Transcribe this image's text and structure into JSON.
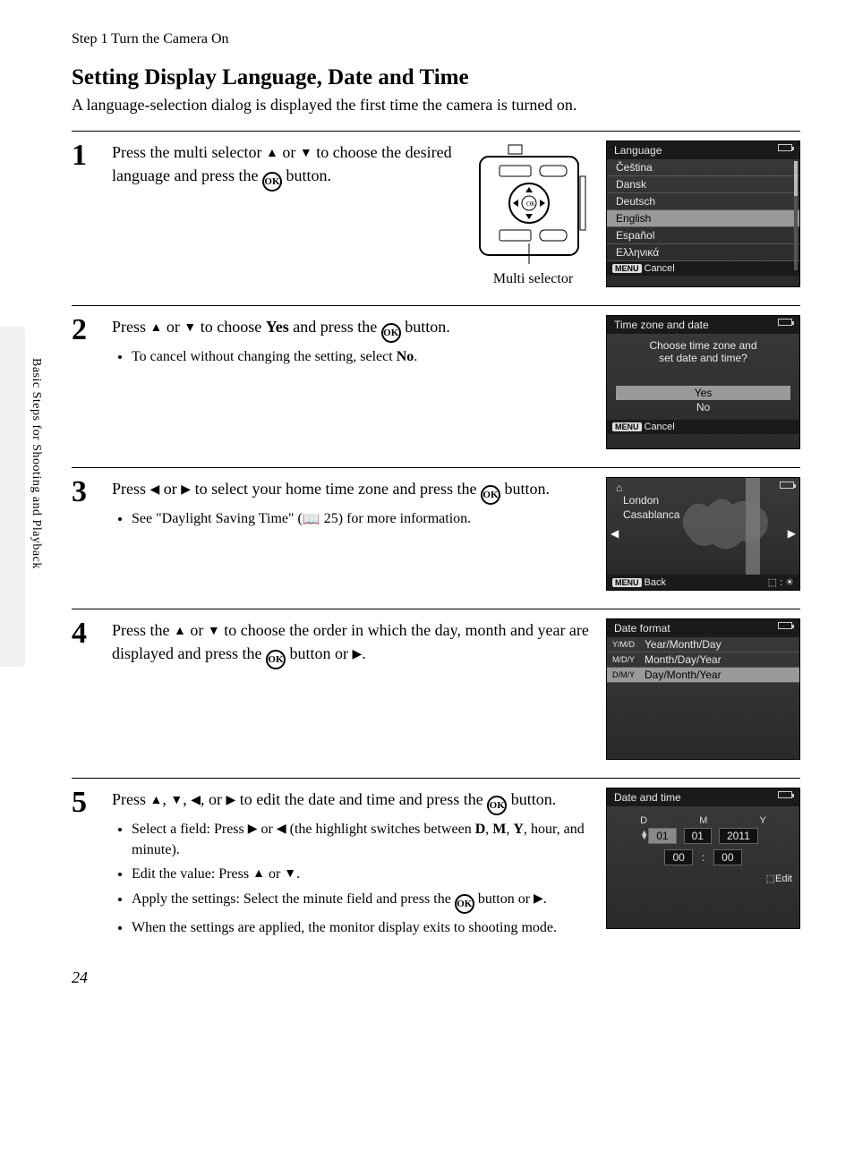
{
  "header": "Step 1 Turn the Camera On",
  "title": "Setting Display Language, Date and Time",
  "subtitle": "A language-selection dialog is displayed the first time the camera is turned on.",
  "sidebar_label": "Basic Steps for Shooting and Playback",
  "multi_selector_caption": "Multi selector",
  "page_number": "24",
  "steps": {
    "s1": {
      "num": "1",
      "text_a": "Press the multi selector ",
      "text_b": " or ",
      "text_c": " to choose the desired language and press the ",
      "text_d": " button."
    },
    "s2": {
      "num": "2",
      "text_a": "Press ",
      "text_b": " or ",
      "text_c": " to choose ",
      "yes": "Yes",
      "text_d": " and press the ",
      "text_e": " button.",
      "bullet1_a": "To cancel without changing the setting, select ",
      "bullet1_no": "No",
      "bullet1_b": "."
    },
    "s3": {
      "num": "3",
      "text_a": "Press ",
      "text_b": " or ",
      "text_c": " to select your home time zone and press the ",
      "text_d": " button.",
      "bullet1_a": "See \"Daylight Saving Time\" (",
      "bullet1_ref": " 25) for more information."
    },
    "s4": {
      "num": "4",
      "text_a": "Press the ",
      "text_b": " or ",
      "text_c": " to choose the order in which the day, month and year are displayed and press the ",
      "text_d": " button or ",
      "text_e": "."
    },
    "s5": {
      "num": "5",
      "text_a": "Press ",
      "text_b": ", ",
      "text_c": ", ",
      "text_d": ", or ",
      "text_e": " to edit the date and time and press the ",
      "text_f": " button.",
      "b1_a": "Select a field: Press ",
      "b1_b": " or ",
      "b1_c": " (the highlight switches between ",
      "b1_D": "D",
      "b1_sep1": ", ",
      "b1_M": "M",
      "b1_sep2": ", ",
      "b1_Y": "Y",
      "b1_d": ", hour, and minute).",
      "b2_a": "Edit the value: Press ",
      "b2_b": " or ",
      "b2_c": ".",
      "b3_a": "Apply the settings: Select the minute field and press the ",
      "b3_b": " button or ",
      "b3_c": ".",
      "b4": "When the settings are applied, the monitor display exits to shooting mode."
    }
  },
  "screens": {
    "lang": {
      "title": "Language",
      "items": [
        "Čeština",
        "Dansk",
        "Deutsch",
        "English",
        "Español",
        "Ελληνικά"
      ],
      "selected_index": 3,
      "footer": "Cancel",
      "menu": "MENU"
    },
    "tz": {
      "title": "Time zone and date",
      "prompt1": "Choose time zone and",
      "prompt2": "set date and time?",
      "yes": "Yes",
      "no": "No",
      "footer": "Cancel",
      "menu": "MENU"
    },
    "map": {
      "city1": "London",
      "city2": "Casablanca",
      "home": "⌂",
      "footer": "Back",
      "menu": "MENU",
      "dst": "☀"
    },
    "df": {
      "title": "Date format",
      "rows": [
        {
          "tag": "Y/M/D",
          "label": "Year/Month/Day"
        },
        {
          "tag": "M/D/Y",
          "label": "Month/Day/Year"
        },
        {
          "tag": "D/M/Y",
          "label": "Day/Month/Year"
        }
      ],
      "selected_index": 2
    },
    "dt": {
      "title": "Date and time",
      "labels": [
        "D",
        "M",
        "Y"
      ],
      "vals": [
        "01",
        "01",
        "2011"
      ],
      "time": [
        "00",
        "00"
      ],
      "edit": "Edit"
    }
  },
  "glyphs": {
    "up": "▲",
    "down": "▼",
    "left": "◀",
    "right": "▶",
    "ok": "OK",
    "book": "📖",
    "battery": ""
  }
}
